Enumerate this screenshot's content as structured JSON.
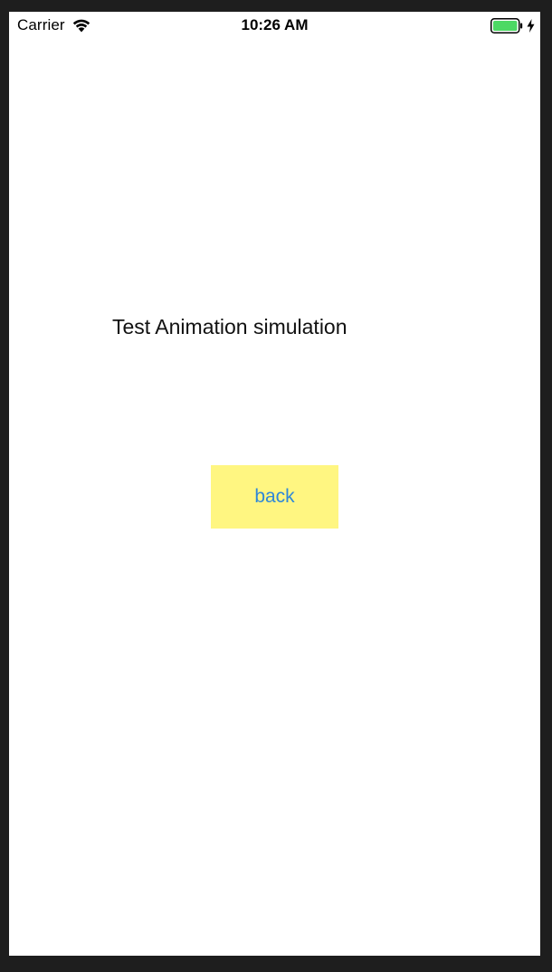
{
  "status_bar": {
    "carrier": "Carrier",
    "time": "10:26 AM",
    "icons": {
      "wifi": "wifi-icon",
      "battery": "battery-icon",
      "charging": "charging-bolt-icon"
    },
    "battery_color": "#4cd964"
  },
  "main": {
    "title": "Test Animation simulation",
    "back_button_label": "back",
    "back_button_bg": "#fff681",
    "back_button_text_color": "#2f88d8"
  }
}
